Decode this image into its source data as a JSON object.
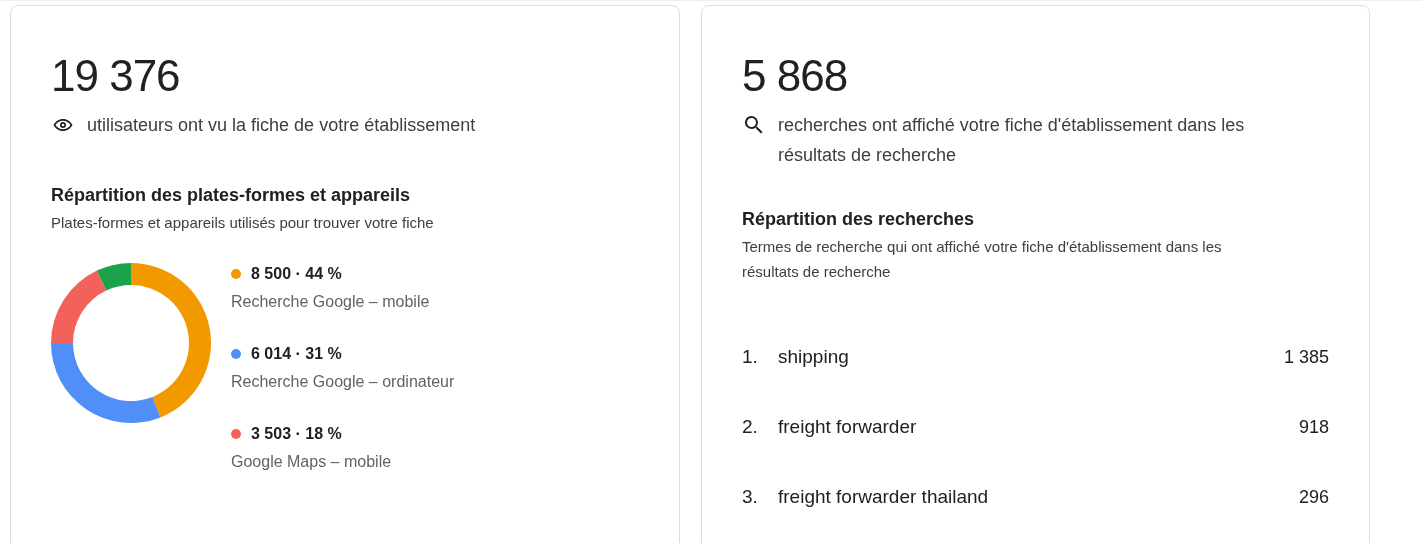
{
  "cards": [
    {
      "kind": "views",
      "total": "19 376",
      "caption": "utilisateurs ont vu la fiche de votre établissement",
      "section_title": "Répartition des plates-formes et appareils",
      "section_description": "Plates-formes et appareils utilisés pour trouver votre fiche",
      "chart_data": {
        "type": "donut",
        "values": [
          44,
          31,
          18,
          7
        ],
        "colors": [
          "#f29900",
          "#4f8ff7",
          "#f3625a",
          "#1aa34a"
        ]
      },
      "legend": [
        {
          "color": "#f29900",
          "reading": "8 500 · 44 %",
          "label": "Recherche Google – mobile"
        },
        {
          "color": "#4f8ff7",
          "reading": "6 014 · 31 %",
          "label": "Recherche Google – ordinateur"
        },
        {
          "color": "#f3625a",
          "reading": "3 503 · 18 %",
          "label": "Google Maps – mobile"
        }
      ]
    },
    {
      "kind": "searches",
      "total": "5 868",
      "caption": "recherches ont affiché votre fiche d'établissement dans les résultats de recherche",
      "section_title": "Répartition des recherches",
      "section_description": "Termes de recherche qui ont affiché votre fiche d'établissement dans les résultats de recherche",
      "terms": [
        {
          "rank": "1.",
          "term": "shipping",
          "count": "1 385"
        },
        {
          "rank": "2.",
          "term": "freight forwarder",
          "count": "918"
        },
        {
          "rank": "3.",
          "term": "freight forwarder thailand",
          "count": "296"
        }
      ]
    }
  ]
}
